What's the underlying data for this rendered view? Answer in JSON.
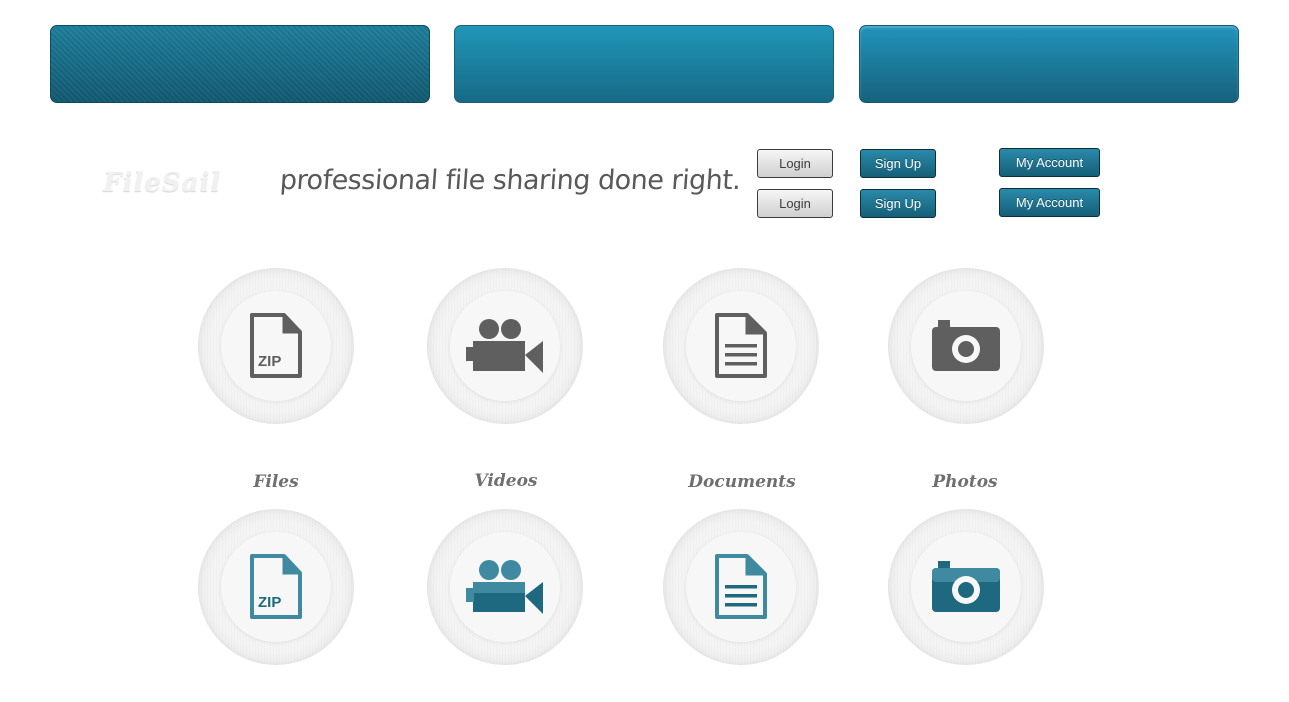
{
  "header": {
    "logo": "FileSail",
    "tagline": "professional file sharing done right."
  },
  "buttons": {
    "login": [
      "Login",
      "Login"
    ],
    "signup": [
      "Sign Up",
      "Sign Up"
    ],
    "account": [
      "My Account",
      "My Account"
    ]
  },
  "categories": [
    {
      "label": "Files",
      "icon": "zip-file-icon"
    },
    {
      "label": "Videos",
      "icon": "video-camera-icon"
    },
    {
      "label": "Documents",
      "icon": "document-icon"
    },
    {
      "label": "Photos",
      "icon": "camera-icon"
    }
  ],
  "icon_text": {
    "zip": "ZIP"
  },
  "colors": {
    "icon_gray": "#5f5f5f",
    "icon_blue": "#1e6880",
    "accent": "#1a7592"
  }
}
